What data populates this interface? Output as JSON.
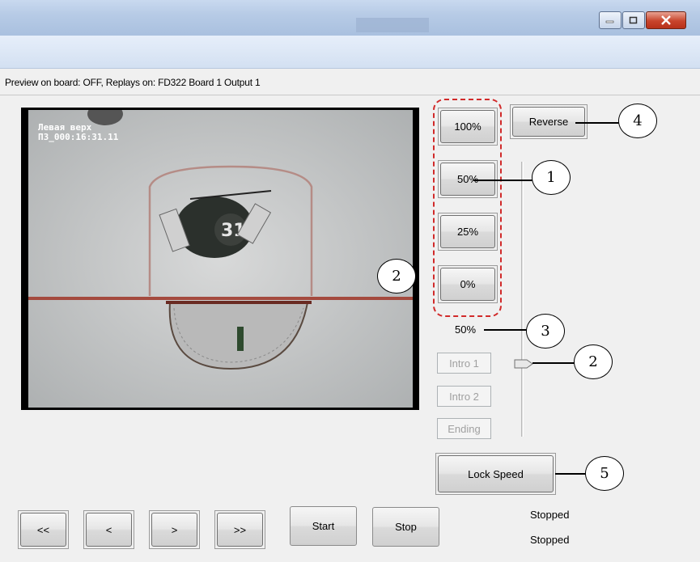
{
  "status_line": "Preview on board: OFF, Replays on: FD322 Board 1 Output 1",
  "overlay": {
    "line1": "Левая верх",
    "line2": "ПЗ_000:16:31.11"
  },
  "speed_buttons": [
    "100%",
    "50%",
    "25%",
    "0%"
  ],
  "reverse_label": "Reverse",
  "speed_value": "50%",
  "macro_buttons": [
    "Intro 1",
    "Intro 2",
    "Ending"
  ],
  "lock_speed_label": "Lock Speed",
  "transport_buttons": [
    "<<",
    "<",
    ">",
    ">>"
  ],
  "start_label": "Start",
  "stop_label": "Stop",
  "status_1": "Stopped",
  "status_2": "Stopped",
  "callouts": [
    "1",
    "2",
    "3",
    "4",
    "5",
    "2"
  ],
  "colors": {
    "dashed_outline": "#d12a2a",
    "titlebar": "#b7cbe6",
    "close_button": "#c8442c"
  },
  "icons": [
    "minimize-icon",
    "maximize-icon",
    "close-icon"
  ]
}
